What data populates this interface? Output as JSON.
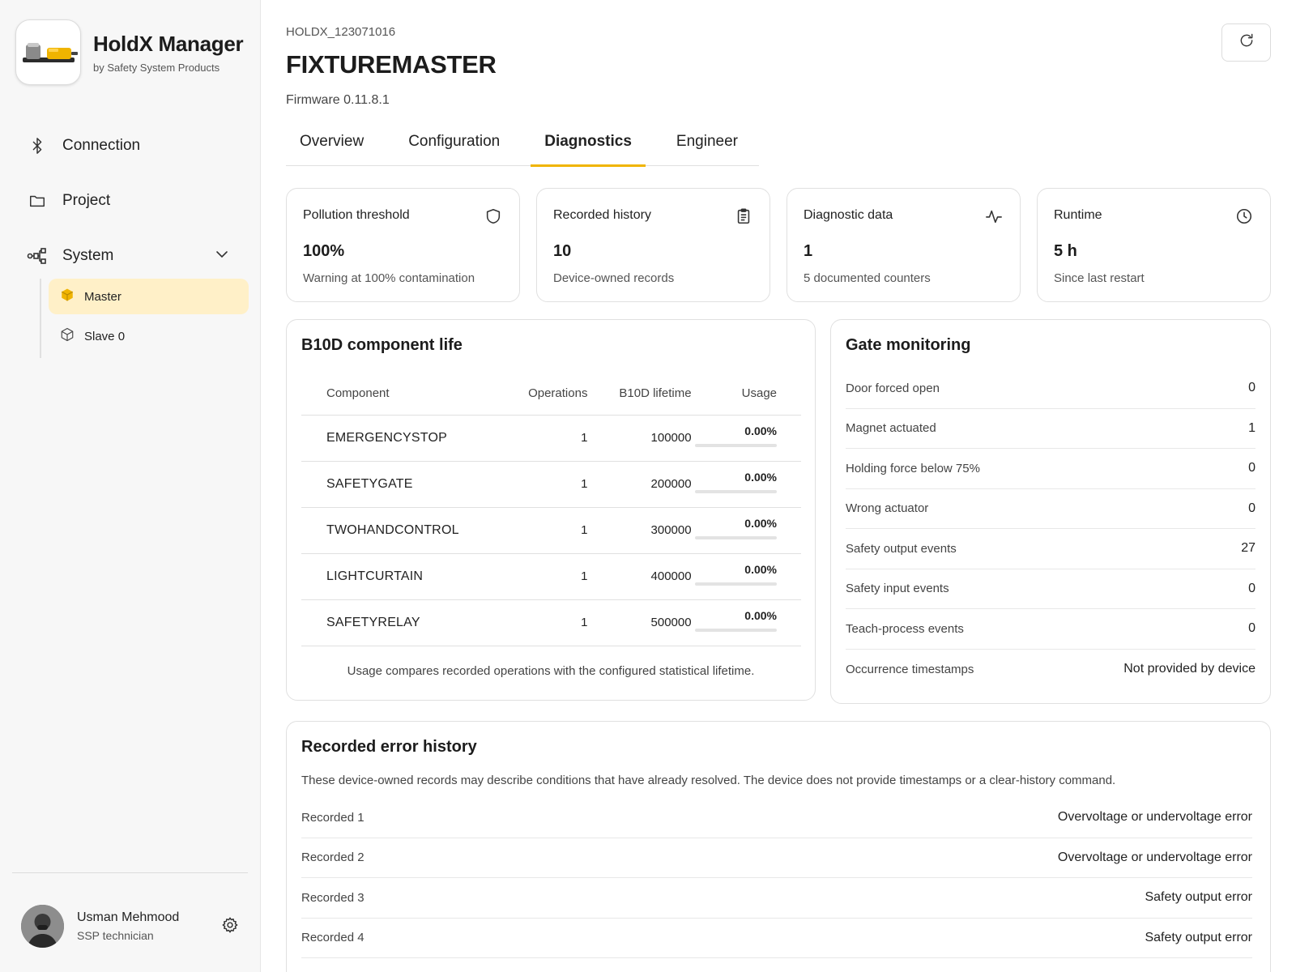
{
  "app": {
    "name": "HoldX Manager",
    "vendor": "by Safety System Products",
    "icon": "product-thumbnail"
  },
  "sidebar": {
    "nav": [
      {
        "label": "Connection",
        "icon": "bluetooth-icon"
      },
      {
        "label": "Project",
        "icon": "folder-icon"
      },
      {
        "label": "System",
        "icon": "system-tree-icon",
        "expanded": true
      }
    ],
    "system_items": [
      {
        "label": "Master",
        "icon": "cube-icon",
        "active": true
      },
      {
        "label": "Slave 0",
        "icon": "cube-icon",
        "active": false
      }
    ],
    "user": {
      "name": "Usman Mehmood",
      "role": "SSP technician"
    }
  },
  "device": {
    "id": "HOLDX_123071016",
    "name": "FIXTUREMASTER",
    "firmware": "Firmware 0.11.8.1"
  },
  "tabs": [
    {
      "label": "Overview",
      "active": false
    },
    {
      "label": "Configuration",
      "active": false
    },
    {
      "label": "Diagnostics",
      "active": true
    },
    {
      "label": "Engineer",
      "active": false
    }
  ],
  "stats": [
    {
      "title": "Pollution threshold",
      "value": "100%",
      "sub": "Warning at 100% contamination",
      "icon": "shield-icon"
    },
    {
      "title": "Recorded history",
      "value": "10",
      "sub": "Device-owned records",
      "icon": "clipboard-icon"
    },
    {
      "title": "Diagnostic data",
      "value": "1",
      "sub": "5 documented counters",
      "icon": "activity-icon"
    },
    {
      "title": "Runtime",
      "value": "5 h",
      "sub": "Since last restart",
      "icon": "clock-icon"
    }
  ],
  "b10d": {
    "title": "B10D component life",
    "headers": {
      "component": "Component",
      "operations": "Operations",
      "lifetime": "B10D lifetime",
      "usage": "Usage"
    },
    "rows": [
      {
        "component": "EMERGENCYSTOP",
        "operations": "1",
        "lifetime": "100000",
        "usage": "0.00%",
        "usage_fraction": 0.0
      },
      {
        "component": "SAFETYGATE",
        "operations": "1",
        "lifetime": "200000",
        "usage": "0.00%",
        "usage_fraction": 0.0
      },
      {
        "component": "TWOHANDCONTROL",
        "operations": "1",
        "lifetime": "300000",
        "usage": "0.00%",
        "usage_fraction": 0.0
      },
      {
        "component": "LIGHTCURTAIN",
        "operations": "1",
        "lifetime": "400000",
        "usage": "0.00%",
        "usage_fraction": 0.0
      },
      {
        "component": "SAFETYRELAY",
        "operations": "1",
        "lifetime": "500000",
        "usage": "0.00%",
        "usage_fraction": 0.0
      }
    ],
    "footnote": "Usage compares recorded operations with the configured statistical lifetime."
  },
  "gate": {
    "title": "Gate monitoring",
    "rows": [
      {
        "label": "Door forced open",
        "value": "0"
      },
      {
        "label": "Magnet actuated",
        "value": "1"
      },
      {
        "label": "Holding force below 75%",
        "value": "0"
      },
      {
        "label": "Wrong actuator",
        "value": "0"
      },
      {
        "label": "Safety output events",
        "value": "27"
      },
      {
        "label": "Safety input events",
        "value": "0"
      },
      {
        "label": "Teach-process events",
        "value": "0"
      },
      {
        "label": "Occurrence timestamps",
        "value": "Not provided by device"
      }
    ]
  },
  "errors": {
    "title": "Recorded error history",
    "description": "These device-owned records may describe conditions that have already resolved. The device does not provide timestamps or a clear-history command.",
    "rows": [
      {
        "label": "Recorded 1",
        "value": "Overvoltage or undervoltage error"
      },
      {
        "label": "Recorded 2",
        "value": "Overvoltage or undervoltage error"
      },
      {
        "label": "Recorded 3",
        "value": "Safety output error"
      },
      {
        "label": "Recorded 4",
        "value": "Safety output error"
      }
    ]
  },
  "colors": {
    "accent": "#f0b400",
    "active_bg": "#fff0c8"
  }
}
